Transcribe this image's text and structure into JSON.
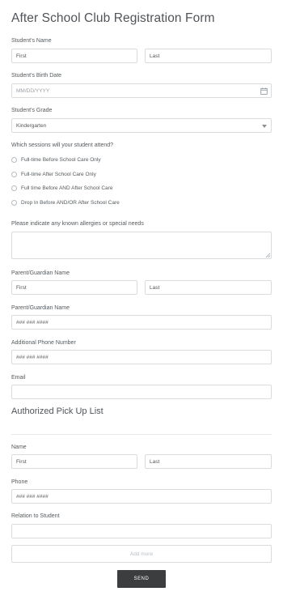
{
  "form": {
    "title": "After School Club Registration Form",
    "student_name": {
      "label": "Student's Name",
      "first_placeholder": "First",
      "last_placeholder": "Last"
    },
    "birth_date": {
      "label": "Student's Birth Date",
      "placeholder": "MM/DD/YYYY",
      "icon": "calendar-icon"
    },
    "grade": {
      "label": "Student's Grade",
      "value": "Kindergarten",
      "icon": "chevron-down-icon"
    },
    "sessions": {
      "label": "Which sessions will your student attend?",
      "options": [
        "Full-time Before School Care Only",
        "Full-time After School Care Only",
        "Full time Before AND After School Care",
        "Drop In Before AND/OR After School Care"
      ]
    },
    "allergies": {
      "label": "Please indicate any known allergies or special needs"
    },
    "guardian_name": {
      "label": "Parent/Guardian Name",
      "first_placeholder": "First",
      "last_placeholder": "Last"
    },
    "guardian_phone": {
      "label": "Parent/Guardian Name",
      "placeholder": "### ### ####"
    },
    "additional_phone": {
      "label": "Additional Phone Number",
      "placeholder": "### ### ####"
    },
    "email": {
      "label": "Email",
      "value": ""
    }
  },
  "pickup": {
    "title": "Authorized Pick Up List",
    "name": {
      "label": "Name",
      "first_placeholder": "First",
      "last_placeholder": "Last"
    },
    "phone": {
      "label": "Phone",
      "placeholder": "### ### ####"
    },
    "relation": {
      "label": "Relation to Student",
      "value": ""
    },
    "add_more_label": "Add more"
  },
  "submit": {
    "label": "SEND"
  },
  "colors": {
    "button_bg": "#3c3d3f",
    "border": "#d9dcdf",
    "text": "#555a5e"
  }
}
